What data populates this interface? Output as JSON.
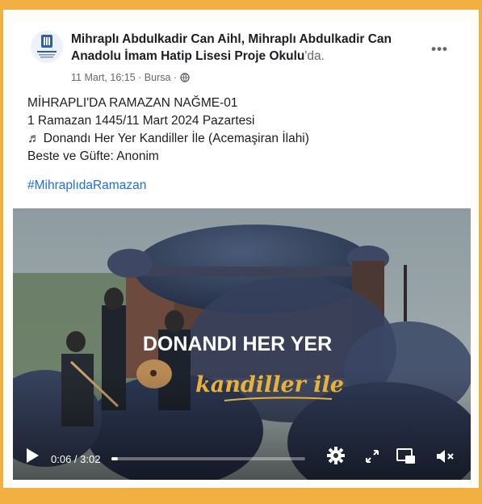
{
  "post": {
    "author": "Mihraplı Abdulkadir Can Aihl",
    "separator": ", ",
    "place": "Mihraplı Abdulkadir Can Anadolu İmam Hatip Lisesi Proje Okulu",
    "place_suffix": "'da.",
    "timestamp": "11 Mart, 16:15",
    "location": "Bursa",
    "dot": " · ",
    "lines": [
      "MİHRAPLI'DA RAMAZAN NAĞME-01",
      "1 Ramazan 1445/11 Mart 2024 Pazartesi",
      "♬ Donandı Her Yer Kandiller İle (Acemaşiran İlahi)",
      "Beste ve Güfte: Anonim"
    ],
    "hashtag": "#MihraplıdaRamazan",
    "more_label": "•••"
  },
  "video": {
    "title_line1": "DONANDI HER YER",
    "title_line2": "kandiller ile",
    "current_time": "0:06",
    "duration": "3:02",
    "time_separator": " / ",
    "progress": 0.033,
    "icons": [
      "play-icon",
      "gear-icon",
      "fullscreen-icon",
      "pip-icon",
      "mute-icon"
    ]
  },
  "colors": {
    "link": "#216fdb",
    "frame": "#f2b042",
    "accent_gold": "#e8b13a"
  }
}
